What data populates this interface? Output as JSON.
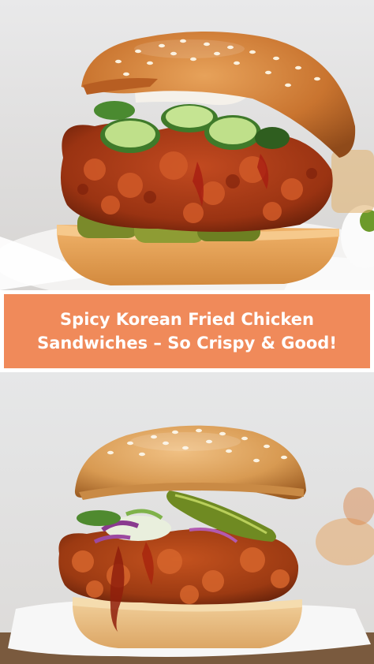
{
  "title": {
    "line1": "Spicy Korean Fried Chicken",
    "line2": "Sandwiches – So Crispy & Good!"
  },
  "colors": {
    "banner_background": "#f08a5a",
    "banner_text": "#ffffff",
    "divider": "#ffffff"
  }
}
